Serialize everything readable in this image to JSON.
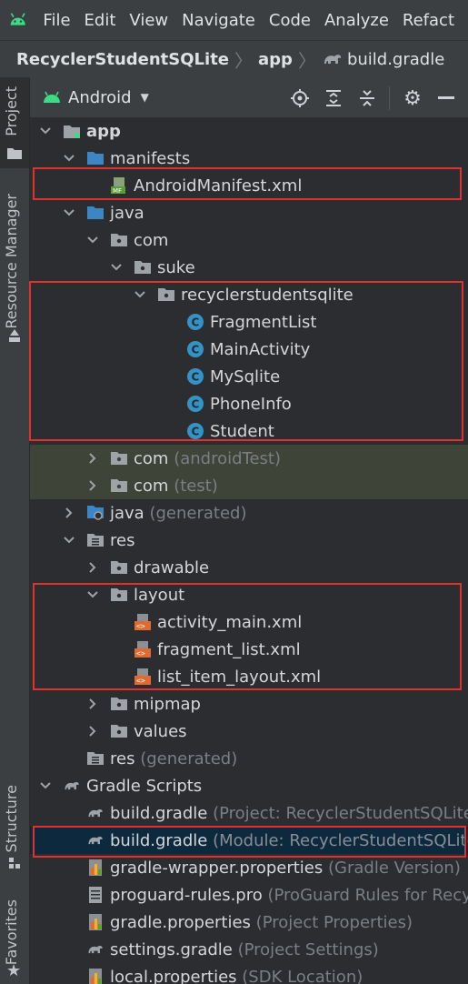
{
  "menubar": {
    "items": [
      "File",
      "Edit",
      "View",
      "Navigate",
      "Code",
      "Analyze",
      "Refact"
    ]
  },
  "breadcrumb": {
    "project": "RecyclerStudentSQLite",
    "module": "app",
    "file": "build.gradle"
  },
  "toolstrip": {
    "project": "Project",
    "resource_manager": "Resource Manager",
    "structure": "Structure",
    "favorites": "Favorites"
  },
  "panel": {
    "view_mode": "Android"
  },
  "tree": {
    "app": "app",
    "manifests": "manifests",
    "manifest_file": "AndroidManifest.xml",
    "java": "java",
    "com": "com",
    "suke": "suke",
    "package": "recyclerstudentsqlite",
    "classes": [
      "FragmentList",
      "MainActivity",
      "MySqlite",
      "PhoneInfo",
      "Student"
    ],
    "com_android_test": "com",
    "com_android_test_hint": "(androidTest)",
    "com_test": "com",
    "com_test_hint": "(test)",
    "java_generated": "java",
    "java_generated_hint": "(generated)",
    "res": "res",
    "drawable": "drawable",
    "layout": "layout",
    "layouts": [
      "activity_main.xml",
      "fragment_list.xml",
      "list_item_layout.xml"
    ],
    "mipmap": "mipmap",
    "values": "values",
    "res_generated": "res",
    "res_generated_hint": "(generated)",
    "gradle_scripts": "Gradle Scripts",
    "gradle_files": [
      {
        "name": "build.gradle",
        "hint": "(Project: RecyclerStudentSQLite)"
      },
      {
        "name": "build.gradle",
        "hint": "(Module: RecyclerStudentSQLite"
      },
      {
        "name": "gradle-wrapper.properties",
        "hint": "(Gradle Version)"
      },
      {
        "name": "proguard-rules.pro",
        "hint": "(ProGuard Rules for Recyc"
      },
      {
        "name": "gradle.properties",
        "hint": "(Project Properties)"
      },
      {
        "name": "settings.gradle",
        "hint": "(Project Settings)"
      },
      {
        "name": "local.properties",
        "hint": "(SDK Location)"
      }
    ]
  },
  "colors": {
    "highlight": "#e0312f",
    "selection": "#0d293e",
    "test_background": "#3e4438",
    "class_icon": "#3592c4"
  }
}
